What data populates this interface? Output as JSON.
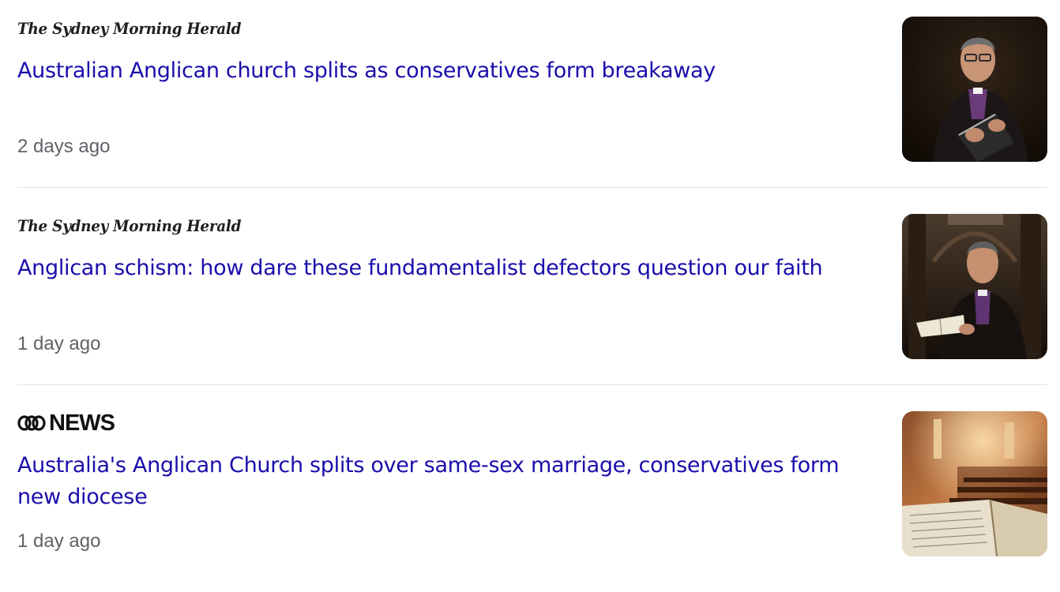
{
  "results": [
    {
      "source": "The Sydney Morning Herald",
      "headline": "Australian Anglican church splits as conservatives form breakaway",
      "age": "2 days ago",
      "thumbnail": "bishop-portrait-image"
    },
    {
      "source": "The Sydney Morning Herald",
      "headline": "Anglican schism: how dare these fundamentalist defectors question our faith",
      "age": "1 day ago",
      "thumbnail": "bishop-in-cathedral-image"
    },
    {
      "source": "NEWS",
      "source_logo": "abc-logo",
      "headline": "Australia's Anglican Church splits over same-sex marriage, conservatives form new diocese",
      "age": "1 day ago",
      "thumbnail": "church-interior-bible-image"
    }
  ],
  "colors": {
    "headline": "#1a0dab",
    "age": "#5f6368",
    "divider": "#e3e3e3"
  }
}
